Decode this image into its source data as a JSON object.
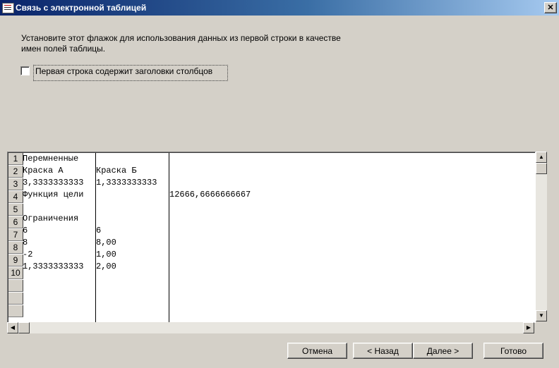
{
  "window": {
    "title": "Связь с электронной таблицей",
    "close_glyph": "✕"
  },
  "instruction": "Установите этот флажок для использования данных из первой строки в качестве имен полей таблицы.",
  "header_checkbox": {
    "label": "Первая строка содержит заголовки столбцов",
    "checked": false
  },
  "grid": {
    "row_numbers": [
      "1",
      "2",
      "3",
      "4",
      "5",
      "6",
      "7",
      "8",
      "9",
      "10",
      "",
      "",
      ""
    ],
    "rows": [
      [
        "Перемненные",
        "",
        ""
      ],
      [
        "Краска А",
        "Краска Б",
        ""
      ],
      [
        "3,3333333333",
        "1,3333333333",
        ""
      ],
      [
        "Функция цели",
        "",
        "12666,6666666667"
      ],
      [
        "",
        "",
        ""
      ],
      [
        "Ограничения",
        "",
        ""
      ],
      [
        "6",
        "6",
        ""
      ],
      [
        "8",
        "8,00",
        ""
      ],
      [
        "-2",
        "1,00",
        ""
      ],
      [
        "1,3333333333",
        "2,00",
        ""
      ]
    ]
  },
  "buttons": {
    "cancel": "Отмена",
    "back": "< Назад",
    "next": "Далее >",
    "finish": "Готово"
  },
  "icons": {
    "scroll_up": "▲",
    "scroll_down": "▼",
    "scroll_left": "◀",
    "scroll_right": "▶"
  }
}
